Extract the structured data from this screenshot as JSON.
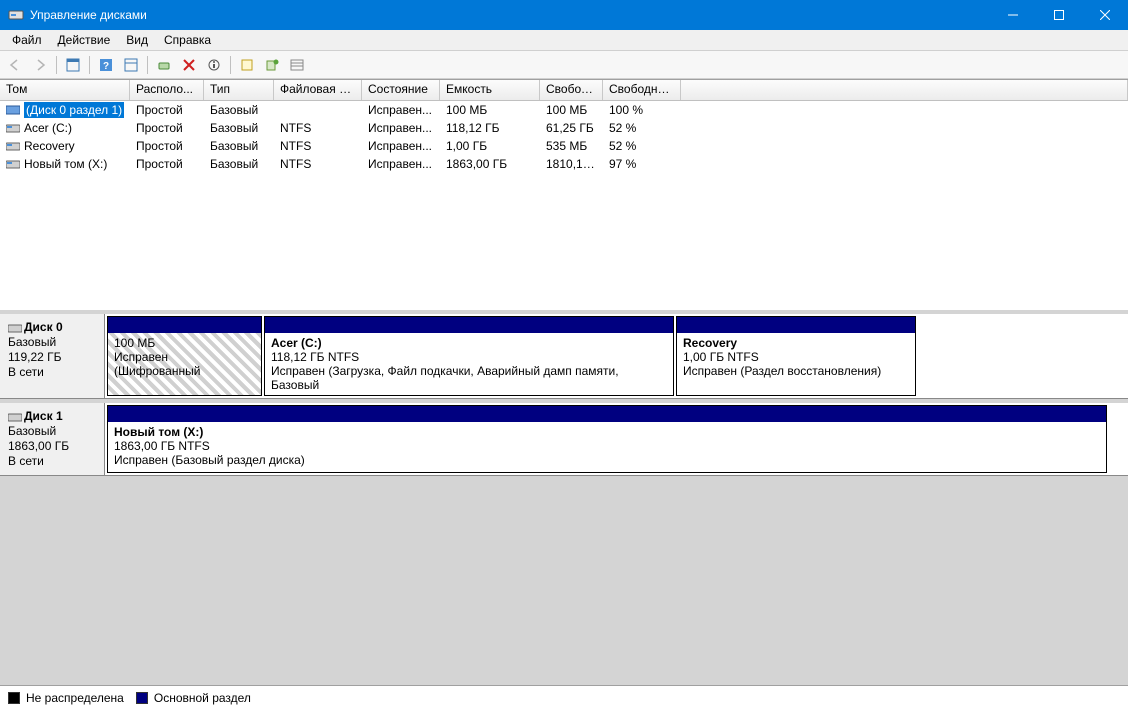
{
  "titlebar": {
    "title": "Управление дисками"
  },
  "menu": {
    "file": "Файл",
    "action": "Действие",
    "view": "Вид",
    "help": "Справка"
  },
  "columns": {
    "volume": "Том",
    "layout": "Располо...",
    "type": "Тип",
    "fs": "Файловая с...",
    "status": "Состояние",
    "capacity": "Емкость",
    "free": "Свобод...",
    "freepct": "Свободно %"
  },
  "volumes": [
    {
      "name": "(Диск 0 раздел 1)",
      "layout": "Простой",
      "type": "Базовый",
      "fs": "",
      "status": "Исправен...",
      "capacity": "100 МБ",
      "free": "100 МБ",
      "freepct": "100 %",
      "selected": true,
      "icon": "partition"
    },
    {
      "name": "Acer (C:)",
      "layout": "Простой",
      "type": "Базовый",
      "fs": "NTFS",
      "status": "Исправен...",
      "capacity": "118,12 ГБ",
      "free": "61,25 ГБ",
      "freepct": "52 %",
      "icon": "drive"
    },
    {
      "name": "Recovery",
      "layout": "Простой",
      "type": "Базовый",
      "fs": "NTFS",
      "status": "Исправен...",
      "capacity": "1,00 ГБ",
      "free": "535 МБ",
      "freepct": "52 %",
      "icon": "drive"
    },
    {
      "name": "Новый том (X:)",
      "layout": "Простой",
      "type": "Базовый",
      "fs": "NTFS",
      "status": "Исправен...",
      "capacity": "1863,00 ГБ",
      "free": "1810,12 ...",
      "freepct": "97 %",
      "icon": "drive"
    }
  ],
  "disks": [
    {
      "name": "Диск 0",
      "type": "Базовый",
      "size": "119,22 ГБ",
      "status": "В сети",
      "partitions": [
        {
          "title": "",
          "line2": "100 МБ",
          "line3": "Исправен (Шифрованный",
          "hatched": true,
          "flex": 155
        },
        {
          "title": "Acer  (C:)",
          "line2": "118,12 ГБ NTFS",
          "line3": "Исправен (Загрузка, Файл подкачки, Аварийный дамп памяти, Базовый",
          "flex": 410
        },
        {
          "title": "Recovery",
          "line2": "1,00 ГБ NTFS",
          "line3": "Исправен (Раздел восстановления)",
          "flex": 240
        }
      ]
    },
    {
      "name": "Диск 1",
      "type": "Базовый",
      "size": "1863,00 ГБ",
      "status": "В сети",
      "partitions": [
        {
          "title": "Новый том  (X:)",
          "line2": "1863,00 ГБ NTFS",
          "line3": "Исправен (Базовый раздел диска)",
          "flex": 1000
        }
      ]
    }
  ],
  "legend": {
    "unallocated": "Не распределена",
    "primary": "Основной раздел"
  }
}
